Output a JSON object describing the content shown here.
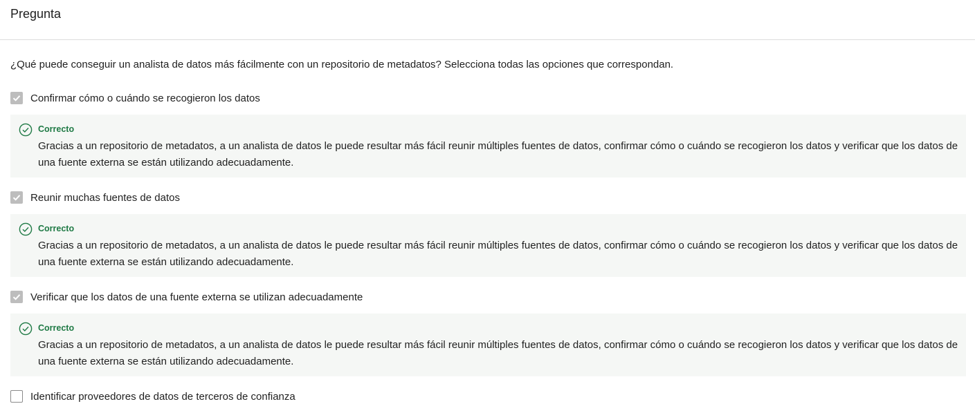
{
  "header": {
    "title": "Pregunta"
  },
  "question": {
    "text": "¿Qué puede conseguir un analista de datos más fácilmente con un repositorio de metadatos? Selecciona todas las opciones que correspondan."
  },
  "options": [
    {
      "label": "Confirmar cómo o cuándo se recogieron los datos",
      "checked": true,
      "feedback": {
        "status": "Correcto",
        "explanation": "Gracias a un repositorio de metadatos, a un analista de datos le puede resultar más fácil reunir múltiples fuentes de datos, confirmar cómo o cuándo se recogieron los datos y verificar que los datos de una fuente externa se están utilizando adecuadamente."
      }
    },
    {
      "label": "Reunir muchas fuentes de datos",
      "checked": true,
      "feedback": {
        "status": "Correcto",
        "explanation": "Gracias a un repositorio de metadatos, a un analista de datos le puede resultar más fácil reunir múltiples fuentes de datos, confirmar cómo o cuándo se recogieron los datos y verificar que los datos de una fuente externa se están utilizando adecuadamente."
      }
    },
    {
      "label": "Verificar que los datos de una fuente externa se utilizan adecuadamente",
      "checked": true,
      "feedback": {
        "status": "Correcto",
        "explanation": "Gracias a un repositorio de metadatos, a un analista de datos le puede resultar más fácil reunir múltiples fuentes de datos, confirmar cómo o cuándo se recogieron los datos y verificar que los datos de una fuente externa se están utilizando adecuadamente."
      }
    },
    {
      "label": "Identificar proveedores de datos de terceros de confianza",
      "checked": false
    }
  ],
  "colors": {
    "correct": "#1f7a45",
    "feedback_bg": "#f5f7f5",
    "checkbox_checked": "#bdbdbd"
  }
}
